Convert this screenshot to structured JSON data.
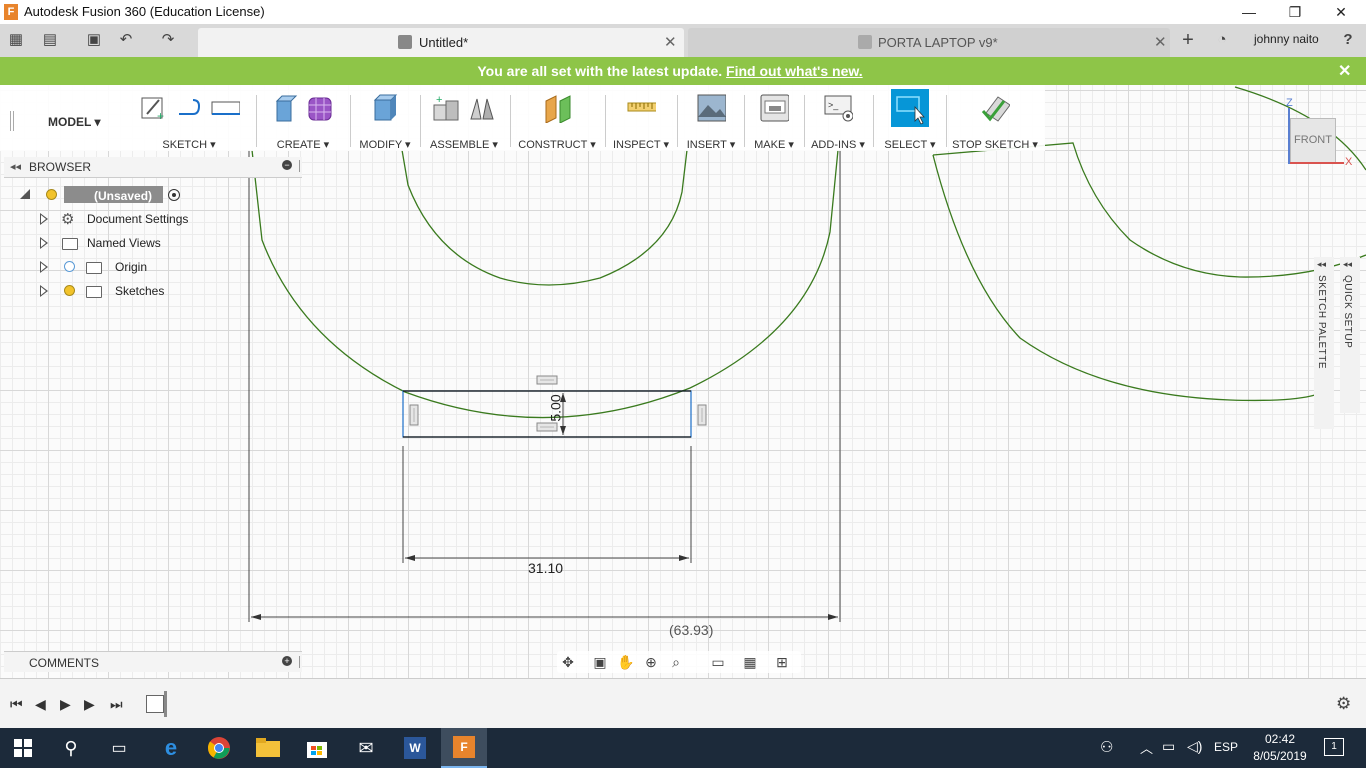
{
  "window": {
    "title": "Autodesk Fusion 360 (Education License)",
    "logo": "F",
    "buttons": {
      "minimize": "—",
      "maximize": "❐",
      "close": "✕"
    }
  },
  "tabs": [
    {
      "label": "Untitled*",
      "close": "✕",
      "active": true
    },
    {
      "label": "PORTA LAPTOP v9*",
      "close": "✕",
      "active": false
    }
  ],
  "topbar": {
    "user": "johnny naito",
    "help": "?",
    "new_tab": "+"
  },
  "banner": {
    "message": "You are all set with the latest update.",
    "link": "Find out what's new.",
    "close": "✕",
    "color": "#8ec548"
  },
  "toolbar": {
    "workspace": "MODEL ▾",
    "groups": [
      {
        "label": "SKETCH ▾"
      },
      {
        "label": "CREATE ▾"
      },
      {
        "label": "MODIFY ▾"
      },
      {
        "label": "ASSEMBLE ▾"
      },
      {
        "label": "CONSTRUCT ▾"
      },
      {
        "label": "INSPECT ▾"
      },
      {
        "label": "INSERT ▾"
      },
      {
        "label": "MAKE ▾"
      },
      {
        "label": "ADD-INS ▾"
      },
      {
        "label": "SELECT ▾"
      },
      {
        "label": "STOP SKETCH ▾"
      }
    ],
    "accent": "#0696d7"
  },
  "browser": {
    "title": "BROWSER",
    "items": [
      {
        "label": "(Unsaved)",
        "icon": "document-icon"
      },
      {
        "label": "Document Settings",
        "icon": "gear-icon"
      },
      {
        "label": "Named Views",
        "icon": "folder-icon"
      },
      {
        "label": "Origin",
        "icon": "folder-icon"
      },
      {
        "label": "Sketches",
        "icon": "folder-icon"
      }
    ]
  },
  "comments": {
    "title": "COMMENTS"
  },
  "viewcube": {
    "face": "FRONT",
    "axis_x": "X",
    "axis_z": "Z"
  },
  "palettes": {
    "sketch": "SKETCH PALETTE",
    "quick": "QUICK SETUP"
  },
  "dimensions": {
    "height": "5.00",
    "width": "31.10",
    "overall": "(63.93)"
  },
  "sketch_colors": {
    "curve": "#3a7a1e",
    "selection": "#1a6fc9"
  },
  "taskbar": {
    "language": "ESP",
    "time": "02:42",
    "date": "8/05/2019",
    "notifications": "1"
  }
}
